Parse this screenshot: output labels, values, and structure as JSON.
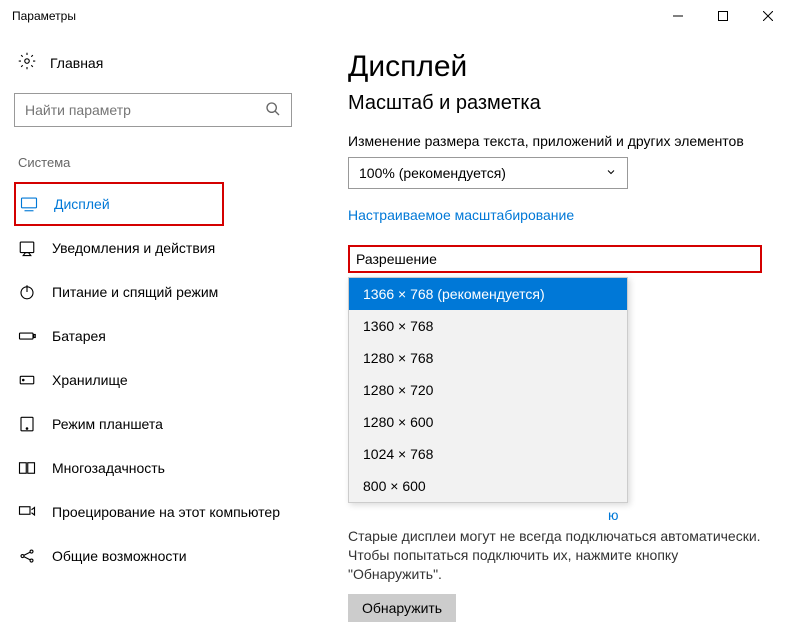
{
  "titlebar": {
    "title": "Параметры"
  },
  "sidebar": {
    "home": "Главная",
    "search_placeholder": "Найти параметр",
    "section": "Система",
    "items": [
      {
        "label": "Дисплей"
      },
      {
        "label": "Уведомления и действия"
      },
      {
        "label": "Питание и спящий режим"
      },
      {
        "label": "Батарея"
      },
      {
        "label": "Хранилище"
      },
      {
        "label": "Режим планшета"
      },
      {
        "label": "Многозадачность"
      },
      {
        "label": "Проецирование на этот компьютер"
      },
      {
        "label": "Общие возможности"
      }
    ]
  },
  "main": {
    "title": "Дисплей",
    "scale_section": "Масштаб и разметка",
    "scale_label": "Изменение размера текста, приложений и других элементов",
    "scale_value": "100% (рекомендуется)",
    "custom_scale_link": "Настраиваемое масштабирование",
    "resolution_label": "Разрешение",
    "resolution_options": [
      "1366 × 768 (рекомендуется)",
      "1360 × 768",
      "1280 × 768",
      "1280 × 720",
      "1280 × 600",
      "1024 × 768",
      "800 × 600"
    ],
    "hidden_link_tail": "ю",
    "detect_para": "Старые дисплеи могут не всегда подключаться автоматически. Чтобы попытаться подключить их, нажмите кнопку \"Обнаружить\".",
    "detect_btn": "Обнаружить"
  }
}
